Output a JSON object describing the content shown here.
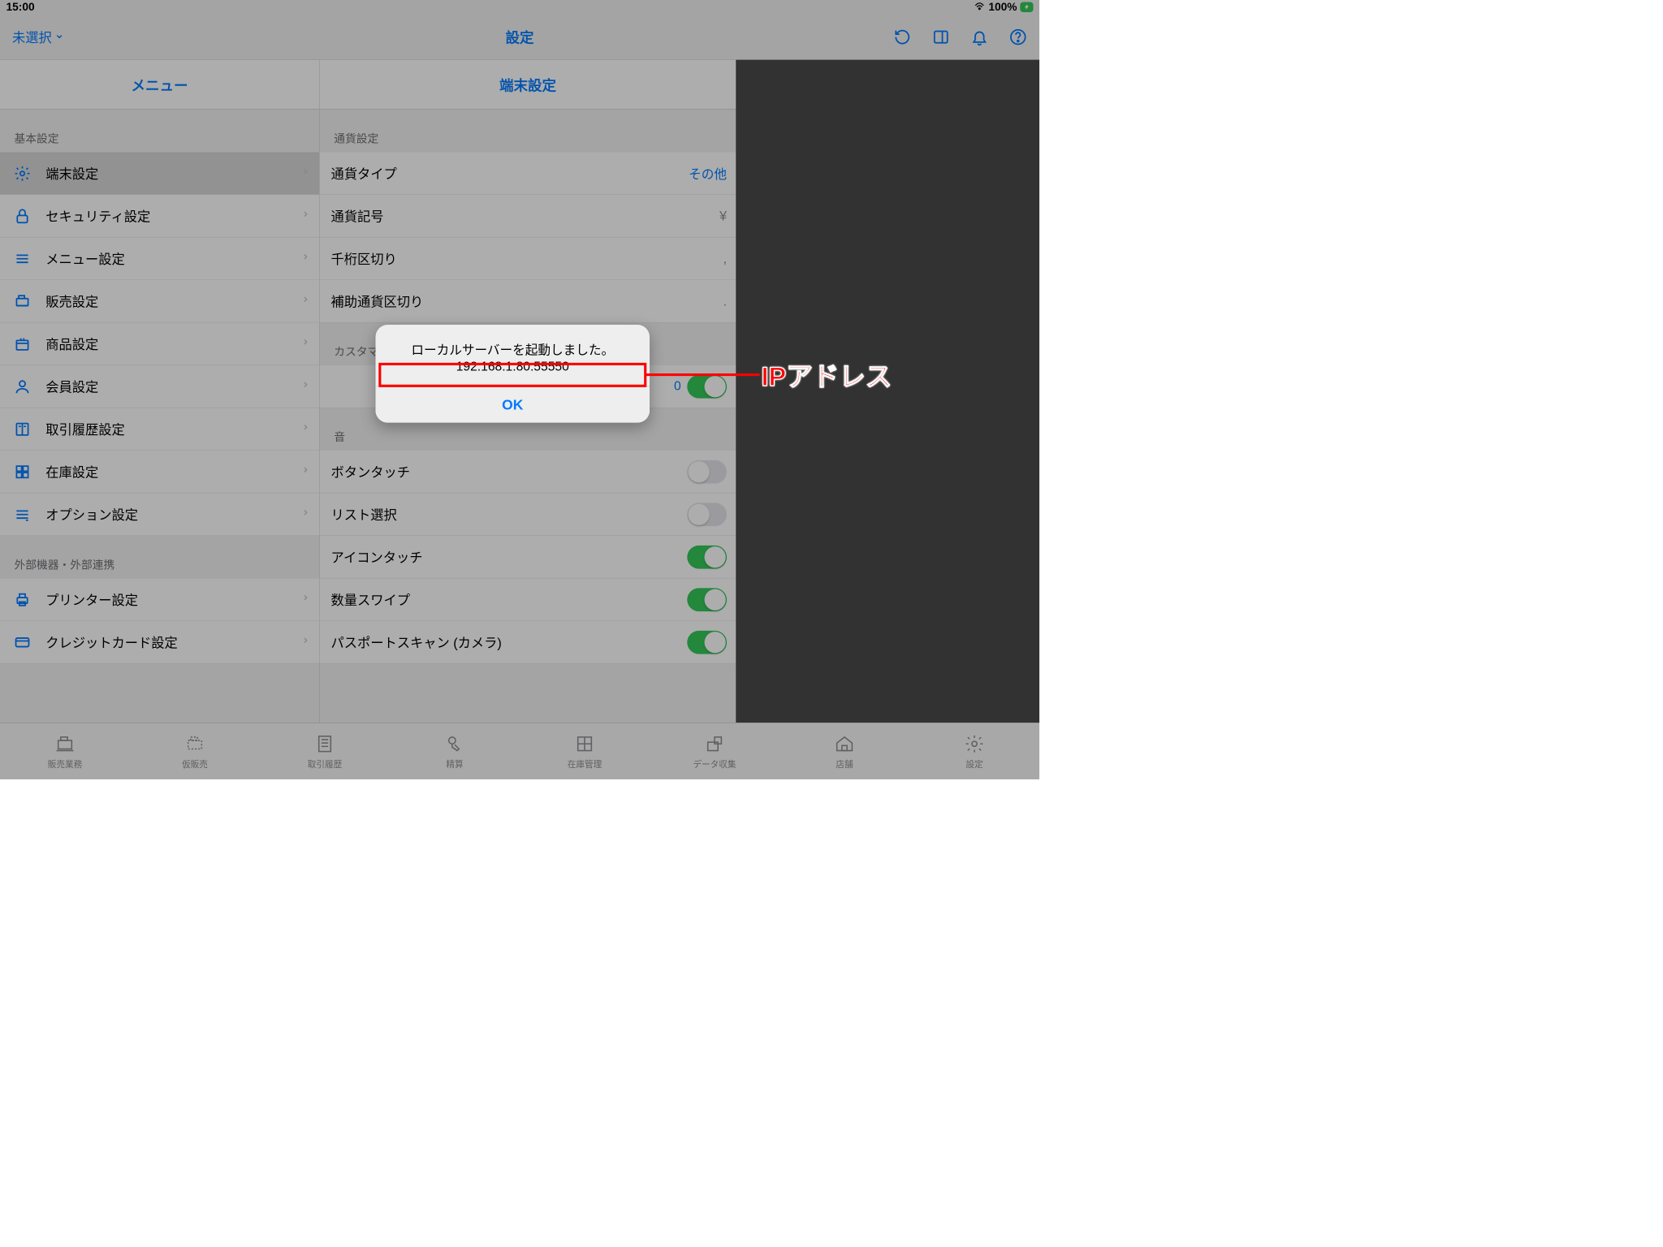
{
  "status": {
    "time": "15:00",
    "battery": "100%"
  },
  "nav": {
    "left_label": "未選択",
    "title": "設定"
  },
  "left_col": {
    "header": "メニュー",
    "section_basic": "基本設定",
    "items_basic": [
      {
        "label": "端末設定",
        "icon": "gear"
      },
      {
        "label": "セキュリティ設定",
        "icon": "lock"
      },
      {
        "label": "メニュー設定",
        "icon": "menu"
      },
      {
        "label": "販売設定",
        "icon": "register"
      },
      {
        "label": "商品設定",
        "icon": "box"
      },
      {
        "label": "会員設定",
        "icon": "user"
      },
      {
        "label": "取引履歴設定",
        "icon": "book"
      },
      {
        "label": "在庫設定",
        "icon": "grid"
      },
      {
        "label": "オプション設定",
        "icon": "sliders"
      }
    ],
    "section_external": "外部機器・外部連携",
    "items_external": [
      {
        "label": "プリンター設定",
        "icon": "printer"
      },
      {
        "label": "クレジットカード設定",
        "icon": "card"
      }
    ]
  },
  "mid_col": {
    "header": "端末設定",
    "section_currency": "通貨設定",
    "rows_currency": [
      {
        "label": "通貨タイプ",
        "value": "その他",
        "value_class": "value"
      },
      {
        "label": "通貨記号",
        "value": "¥",
        "value_class": "value-gray"
      },
      {
        "label": "千桁区切り",
        "value": ",",
        "value_class": "value-gray"
      },
      {
        "label": "補助通貨区切り",
        "value": ".",
        "value_class": "value-gray"
      }
    ],
    "section_customer_partial": "カスタマ",
    "customer_toggle_value": "0",
    "section_sound": "音",
    "rows_sound": [
      {
        "label": "ボタンタッチ",
        "on": false
      },
      {
        "label": "リスト選択",
        "on": false
      },
      {
        "label": "アイコンタッチ",
        "on": true
      },
      {
        "label": "数量スワイプ",
        "on": true
      },
      {
        "label": "パスポートスキャン (カメラ)",
        "on": true
      }
    ]
  },
  "tabbar": [
    {
      "label": "販売業務"
    },
    {
      "label": "仮販売"
    },
    {
      "label": "取引履歴"
    },
    {
      "label": "精算"
    },
    {
      "label": "在庫管理"
    },
    {
      "label": "データ収集"
    },
    {
      "label": "店舗"
    },
    {
      "label": "設定"
    }
  ],
  "modal": {
    "title": "ローカルサーバーを起動しました。",
    "ip": "192.168.1.80:55550",
    "ok": "OK"
  },
  "annotation": {
    "label": "IPアドレス"
  }
}
